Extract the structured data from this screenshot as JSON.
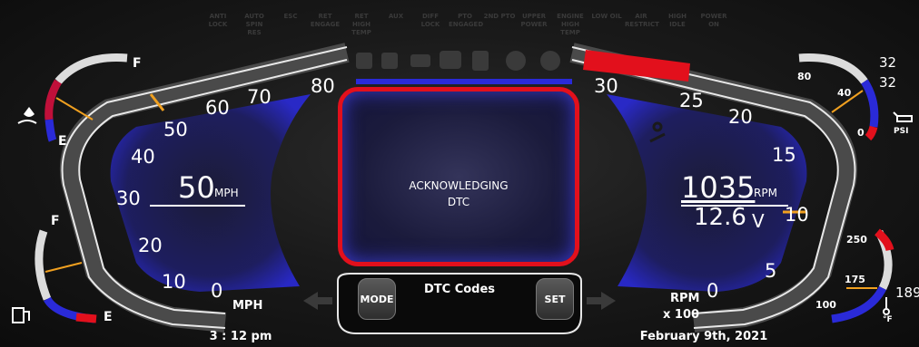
{
  "warning_labels": [
    "ANTI LOCK",
    "AUTO SPIN RES",
    "ESC",
    "RET ENGAGE",
    "RET HIGH TEMP",
    "AUX",
    "DIFF LOCK",
    "PTO ENGAGED",
    "2ND PTO",
    "UPPER POWER",
    "ENGINE HIGH TEMP",
    "LOW OIL",
    "AIR RESTRICT",
    "HIGH IDLE",
    "POWER ON"
  ],
  "speedometer": {
    "ticks": [
      "80",
      "70",
      "60",
      "50",
      "40",
      "30",
      "20",
      "10",
      "0"
    ],
    "unit": "MPH",
    "value": "50",
    "value_unit": "MPH",
    "current_value": 50
  },
  "tachometer": {
    "ticks": [
      "30",
      "25",
      "20",
      "15",
      "10",
      "5",
      "0"
    ],
    "unit": "RPM",
    "multiplier": "x 100",
    "rpm_value": "1035",
    "rpm_unit": "RPM",
    "voltage_value": "12.6",
    "voltage_unit": "V",
    "current_value": 10.35
  },
  "center_screen": {
    "message_line1": "ACKNOWLEDGING",
    "message_line2": "DTC"
  },
  "menu": {
    "title": "DTC Codes",
    "mode_label": "MODE",
    "set_label": "SET"
  },
  "fuel_gauge": {
    "full_label": "F",
    "empty_label": "E",
    "level": 0.55
  },
  "def_gauge": {
    "full_label": "F",
    "empty_label": "E",
    "level": 0.6
  },
  "oil_pressure_gauge": {
    "high_label": "80",
    "mid_label": "40",
    "low_label": "0",
    "unit": "PSI",
    "reading": "32",
    "reading_echo": "32"
  },
  "coolant_temp_gauge": {
    "high_label": "250",
    "mid_label": "175",
    "low_label": "100",
    "unit": "°F",
    "reading": "189"
  },
  "time": "3 : 12 pm",
  "date": "February 9th, 2021",
  "colors": {
    "accent_blue": "#2a2ad8",
    "alert_red": "#e2101c",
    "needle_orange": "#f0a020"
  }
}
